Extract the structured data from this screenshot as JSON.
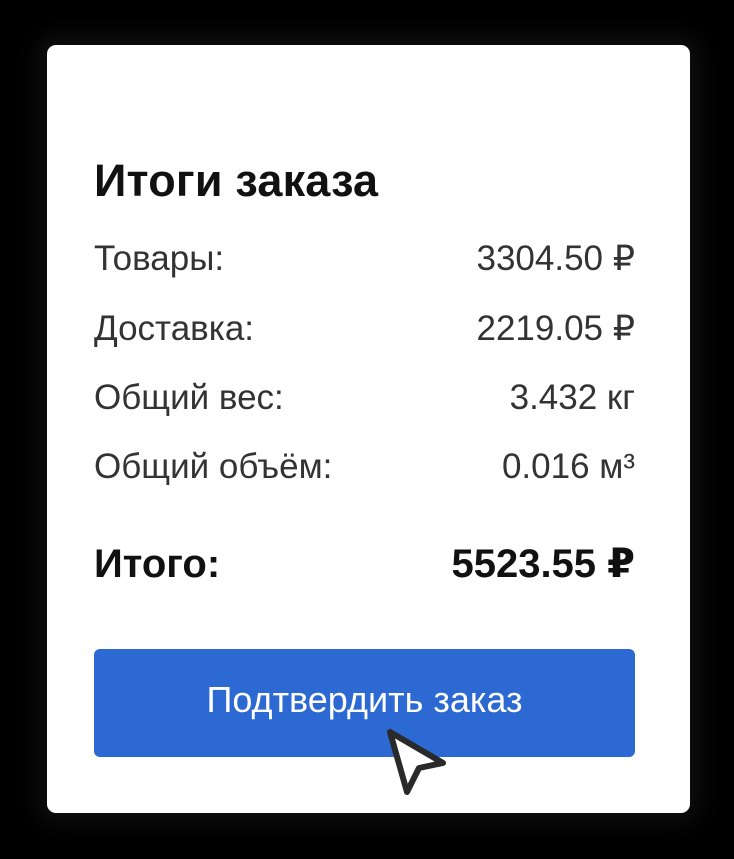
{
  "summary": {
    "title": "Итоги заказа",
    "rows": [
      {
        "label": "Товары:",
        "value": "3304.50 ₽"
      },
      {
        "label": "Доставка:",
        "value": "2219.05 ₽"
      },
      {
        "label": "Общий вес:",
        "value": "3.432 кг"
      },
      {
        "label": "Общий объём:",
        "value": "0.016 м³"
      }
    ],
    "total": {
      "label": "Итого:",
      "value": "5523.55 ₽"
    },
    "confirm_label": "Подтвердить заказ"
  },
  "colors": {
    "accent": "#2c69d2",
    "background": "#000000",
    "card": "#ffffff"
  },
  "icons": {
    "cursor": "mouse-pointer-icon"
  }
}
